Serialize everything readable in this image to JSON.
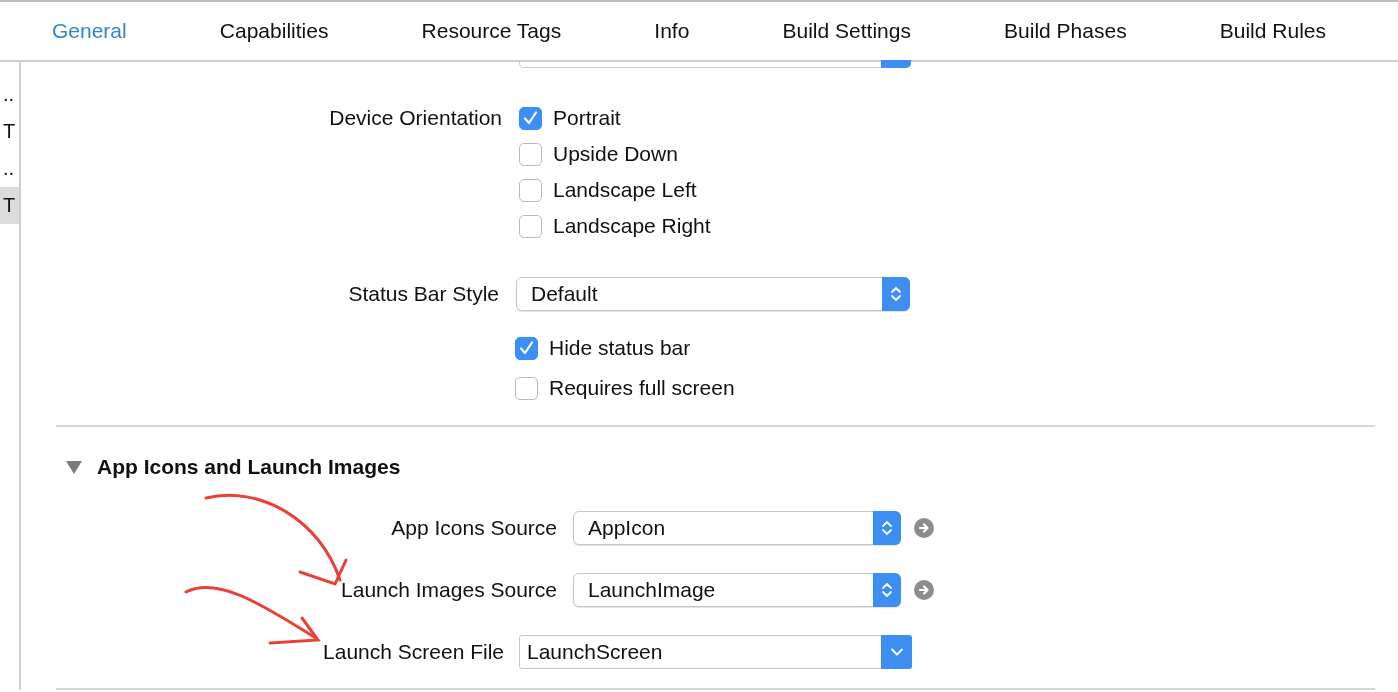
{
  "tabs": [
    {
      "label": "General",
      "selected": true
    },
    {
      "label": "Capabilities",
      "selected": false
    },
    {
      "label": "Resource Tags",
      "selected": false
    },
    {
      "label": "Info",
      "selected": false
    },
    {
      "label": "Build Settings",
      "selected": false
    },
    {
      "label": "Build Phases",
      "selected": false
    },
    {
      "label": "Build Rules",
      "selected": false
    }
  ],
  "sidebar": {
    "items": [
      {
        "label": "..",
        "selected": false
      },
      {
        "label": "T",
        "selected": false
      },
      {
        "label": "..",
        "selected": false
      },
      {
        "label": "T",
        "selected": true
      }
    ]
  },
  "device_orientation": {
    "label": "Device Orientation",
    "options": [
      {
        "label": "Portrait",
        "checked": true
      },
      {
        "label": "Upside Down",
        "checked": false
      },
      {
        "label": "Landscape Left",
        "checked": false
      },
      {
        "label": "Landscape Right",
        "checked": false
      }
    ]
  },
  "status_bar_style": {
    "label": "Status Bar Style",
    "value": "Default"
  },
  "status_bar_options": [
    {
      "label": "Hide status bar",
      "checked": true
    },
    {
      "label": "Requires full screen",
      "checked": false
    }
  ],
  "app_icons_section": {
    "title": "App Icons and Launch Images",
    "expanded": true,
    "rows": [
      {
        "kind": "popup_link",
        "label": "App Icons Source",
        "value": "AppIcon"
      },
      {
        "kind": "popup_link",
        "label": "Launch Images Source",
        "value": "LaunchImage"
      },
      {
        "kind": "combo",
        "label": "Launch Screen File",
        "value": "LaunchScreen"
      }
    ]
  }
}
